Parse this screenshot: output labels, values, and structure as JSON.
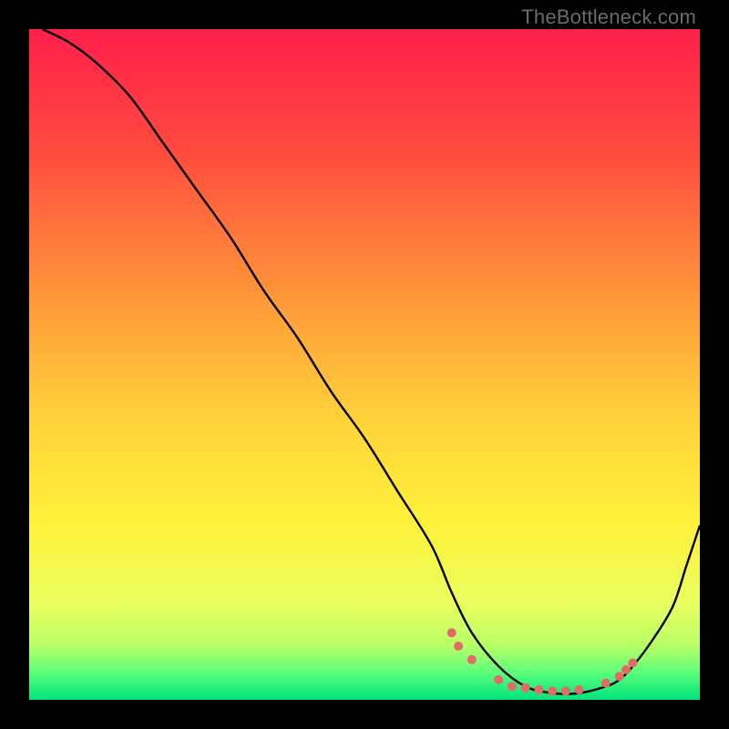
{
  "watermark": "TheBottleneck.com",
  "chart_data": {
    "type": "line",
    "xlabel": "",
    "ylabel": "",
    "xlim": [
      0,
      100
    ],
    "ylim": [
      0,
      100
    ],
    "grid": false,
    "gradient_stops": [
      {
        "pct": 0,
        "color": "#ff1f4b"
      },
      {
        "pct": 18,
        "color": "#ff4a3e"
      },
      {
        "pct": 40,
        "color": "#ff983a"
      },
      {
        "pct": 58,
        "color": "#ffd23a"
      },
      {
        "pct": 74,
        "color": "#fff23a"
      },
      {
        "pct": 86,
        "color": "#e8ff60"
      },
      {
        "pct": 92,
        "color": "#b6ff66"
      },
      {
        "pct": 96,
        "color": "#5aff7a"
      },
      {
        "pct": 100,
        "color": "#00e37a"
      }
    ],
    "series": [
      {
        "name": "bottleneck-curve",
        "color": "#000000",
        "x": [
          2,
          6,
          10,
          15,
          20,
          25,
          30,
          35,
          40,
          45,
          50,
          55,
          60,
          63,
          66,
          70,
          74,
          78,
          82,
          86,
          88,
          90,
          93,
          96,
          98,
          100
        ],
        "y": [
          100,
          98,
          95,
          90,
          83,
          76,
          69,
          61,
          54,
          46,
          39,
          31,
          23,
          16,
          10,
          5,
          2,
          1,
          1,
          2,
          3,
          5,
          9,
          14,
          20,
          26
        ]
      }
    ],
    "markers": {
      "name": "sample-points",
      "color": "#e46a6a",
      "radius": 5,
      "x": [
        63,
        64,
        66,
        70,
        72,
        74,
        76,
        78,
        80,
        82,
        86,
        88,
        89,
        90
      ],
      "y": [
        10,
        8,
        6,
        3,
        2,
        1.8,
        1.5,
        1.3,
        1.3,
        1.5,
        2.5,
        3.5,
        4.5,
        5.5
      ]
    }
  }
}
